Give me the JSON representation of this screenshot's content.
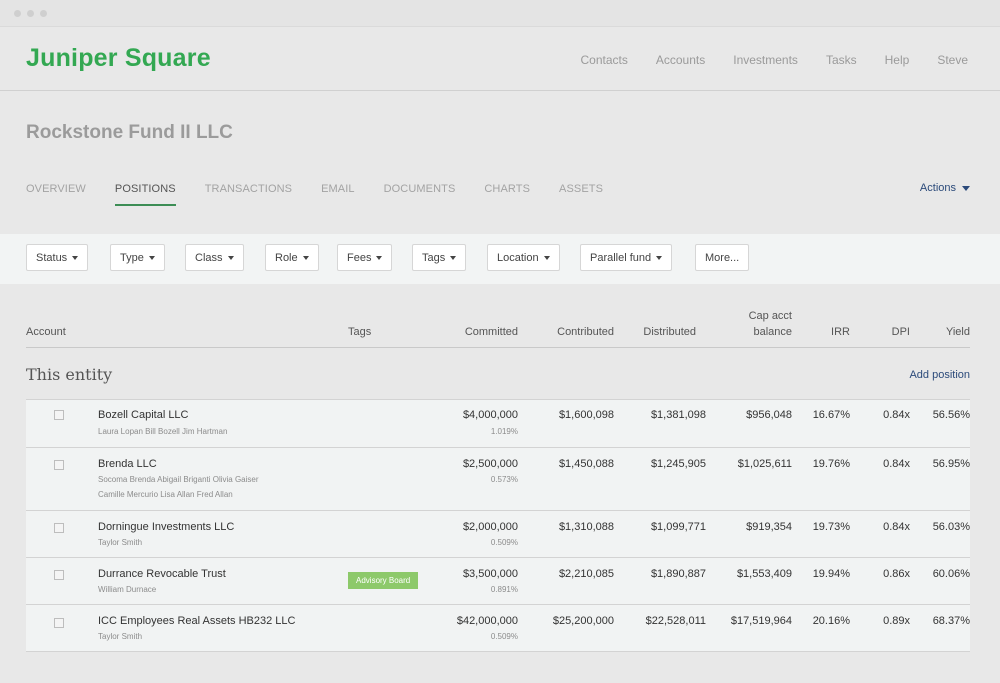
{
  "app": {
    "logo": "Juniper Square",
    "nav": [
      "Contacts",
      "Accounts",
      "Investments",
      "Tasks",
      "Help",
      "Steve"
    ]
  },
  "fund": {
    "title": "Rockstone Fund II LLC",
    "tabs": [
      "OVERVIEW",
      "POSITIONS",
      "TRANSACTIONS",
      "EMAIL",
      "DOCUMENTS",
      "CHARTS",
      "ASSETS"
    ],
    "active_tab": "POSITIONS",
    "actions_label": "Actions"
  },
  "filters": [
    "Status",
    "Type",
    "Class",
    "Role",
    "Fees",
    "Tags",
    "Location",
    "Parallel fund",
    "More..."
  ],
  "table": {
    "columns": {
      "account": "Account",
      "tags": "Tags",
      "committed": "Committed",
      "contributed": "Contributed",
      "distributed": "Distributed",
      "cap_line1": "Cap acct",
      "cap_line2": "balance",
      "irr": "IRR",
      "dpi": "DPI",
      "yield": "Yield"
    },
    "section_title": "This entity",
    "add_position": "Add position",
    "rows": [
      {
        "name": "Bozell Capital LLC",
        "sub1": "Laura Lopan  Bill Bozell  Jim Hartman",
        "sub2": "",
        "tag": "",
        "committed": "$4,000,000",
        "committed_pct": "1.019%",
        "contributed": "$1,600,098",
        "distributed": "$1,381,098",
        "cap": "$956,048",
        "irr": "16.67%",
        "dpi": "0.84x",
        "yield": "56.56%"
      },
      {
        "name": "Brenda LLC",
        "sub1": "Socoma Brenda  Abigail Briganti  Olivia Gaiser",
        "sub2": "Camille Mercurio  Lisa Allan  Fred Allan",
        "tag": "",
        "committed": "$2,500,000",
        "committed_pct": "0.573%",
        "contributed": "$1,450,088",
        "distributed": "$1,245,905",
        "cap": "$1,025,611",
        "irr": "19.76%",
        "dpi": "0.84x",
        "yield": "56.95%"
      },
      {
        "name": "Dorningue Investments LLC",
        "sub1": "Taylor Smith",
        "sub2": "",
        "tag": "",
        "committed": "$2,000,000",
        "committed_pct": "0.509%",
        "contributed": "$1,310,088",
        "distributed": "$1,099,771",
        "cap": "$919,354",
        "irr": "19.73%",
        "dpi": "0.84x",
        "yield": "56.03%"
      },
      {
        "name": "Durrance Revocable Trust",
        "sub1": "William Durnace",
        "sub2": "",
        "tag": "Advisory Board",
        "committed": "$3,500,000",
        "committed_pct": "0.891%",
        "contributed": "$2,210,085",
        "distributed": "$1,890,887",
        "cap": "$1,553,409",
        "irr": "19.94%",
        "dpi": "0.86x",
        "yield": "60.06%"
      },
      {
        "name": "ICC Employees Real Assets HB232 LLC",
        "sub1": "Taylor Smith",
        "sub2": "",
        "tag": "",
        "committed": "$42,000,000",
        "committed_pct": "0.509%",
        "contributed": "$25,200,000",
        "distributed": "$22,528,011",
        "cap": "$17,519,964",
        "irr": "20.16%",
        "dpi": "0.89x",
        "yield": "68.37%"
      }
    ]
  },
  "colors": {
    "brand": "#33a852",
    "link": "#2b4a7a",
    "tag_badge": "#8dc96a",
    "active_underline": "#3c8d55"
  }
}
